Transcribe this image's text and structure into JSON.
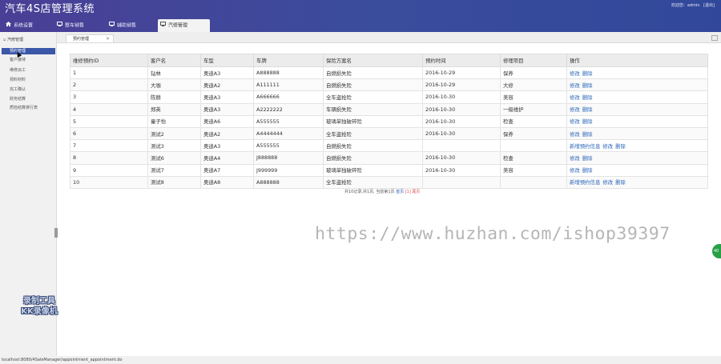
{
  "app": {
    "title": "汽车4S店管理系统"
  },
  "user_bar": {
    "greeting": "欢迎您：admin",
    "logout": "[退出]"
  },
  "top_tabs": [
    {
      "label": "系统设置",
      "icon": "home-icon"
    },
    {
      "label": "整车销售",
      "icon": "monitor-icon"
    },
    {
      "label": "辅助销售",
      "icon": "monitor-icon"
    },
    {
      "label": "汽修管理",
      "icon": "monitor-icon"
    }
  ],
  "sidebar": {
    "heading": "汽修管理",
    "items": [
      {
        "label": "预约管理"
      },
      {
        "label": "客户接待"
      },
      {
        "label": "维修派工"
      },
      {
        "label": "领料材料"
      },
      {
        "label": "完工确认"
      },
      {
        "label": "财务结算"
      },
      {
        "label": "质检结算排行表"
      }
    ]
  },
  "content_tab": {
    "label": "预约管理",
    "close": "×"
  },
  "table": {
    "headers": [
      "维修预约ID",
      "客户名",
      "车型",
      "车牌",
      "保险方案名",
      "预约时间",
      "修理项目",
      "操作"
    ],
    "rows": [
      {
        "id": "1",
        "name": "钻林",
        "model": "奥迪A3",
        "plate": "A888888",
        "plan": "自燃损失险",
        "time": "2016-10-29",
        "item": "保养",
        "ops": [
          "修改",
          "删除"
        ]
      },
      {
        "id": "2",
        "name": "大咖",
        "model": "奥迪A2",
        "plate": "A111111",
        "plan": "自燃损失险",
        "time": "2016-10-29",
        "item": "大修",
        "ops": [
          "修改",
          "删除"
        ]
      },
      {
        "id": "3",
        "name": "陈赫",
        "model": "奥迪A3",
        "plate": "A666666",
        "plan": "全车盗抢险",
        "time": "2016-10-30",
        "item": "美容",
        "ops": [
          "修改",
          "删除"
        ]
      },
      {
        "id": "4",
        "name": "郑英",
        "model": "奥迪A3",
        "plate": "A2222222",
        "plan": "车辆损失险",
        "time": "2016-10-30",
        "item": "一级维护",
        "ops": [
          "修改",
          "删除"
        ]
      },
      {
        "id": "5",
        "name": "童子怡",
        "model": "奥迪A6",
        "plate": "A555555",
        "plan": "玻璃单独破碎险",
        "time": "2016-10-30",
        "item": "检查",
        "ops": [
          "修改",
          "删除"
        ]
      },
      {
        "id": "6",
        "name": "测试2",
        "model": "奥迪A2",
        "plate": "A4444444",
        "plan": "全车盗抢险",
        "time": "2016-10-30",
        "item": "保养",
        "ops": [
          "修改",
          "删除"
        ]
      },
      {
        "id": "7",
        "name": "测试3",
        "model": "奥迪A3",
        "plate": "A555555",
        "plan": "自燃损失险",
        "time": "",
        "item": "",
        "ops": [
          "新增预约信息",
          "修改",
          "删除"
        ]
      },
      {
        "id": "8",
        "name": "测试6",
        "model": "奥迪A4",
        "plate": "J888888",
        "plan": "自燃损失险",
        "time": "2016-10-30",
        "item": "检查",
        "ops": [
          "修改",
          "删除"
        ]
      },
      {
        "id": "9",
        "name": "测试7",
        "model": "奥迪A7",
        "plate": "J999999",
        "plan": "玻璃单独破碎险",
        "time": "2016-10-30",
        "item": "美容",
        "ops": [
          "修改",
          "删除"
        ]
      },
      {
        "id": "10",
        "name": "测试8",
        "model": "奥迪A8",
        "plate": "A888888",
        "plan": "全车盗抢险",
        "time": "",
        "item": "",
        "ops": [
          "新增预约信息",
          "修改",
          "删除"
        ]
      }
    ]
  },
  "pager": {
    "summary": "共10记录,共1页, 当前第1页",
    "first": "首页",
    "current": "[1]",
    "last": "尾页"
  },
  "watermark": "https://www.huzhan.com/ishop39397",
  "recorder_logo": {
    "line1": "录制工具",
    "line2": "KK录像机"
  },
  "float_button": "40",
  "status_bar": {
    "url": "localhost:8080/4SaleManager/appointment_appointment.do"
  },
  "colors": {
    "header": "#3b4c9c",
    "active_sidebar": "#3a57a8",
    "link": "#2a66b8",
    "float_button": "#27a046"
  }
}
